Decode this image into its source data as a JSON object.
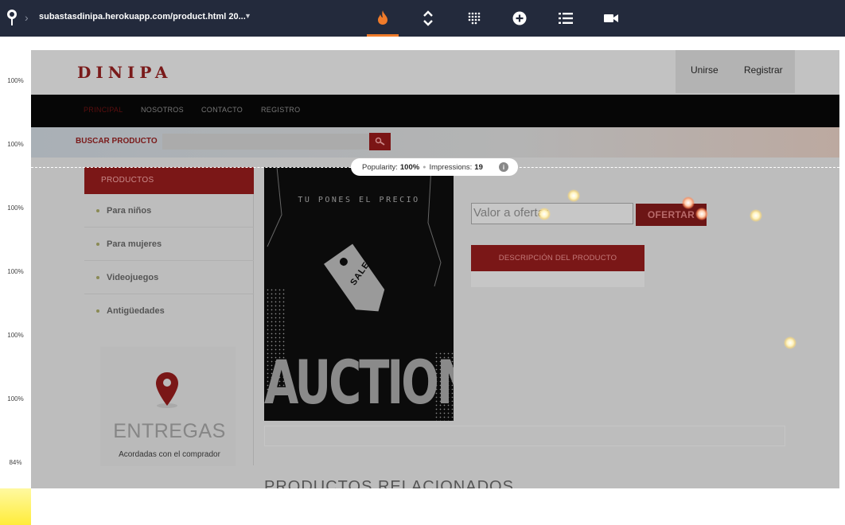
{
  "toolbar": {
    "url": "subastasdinipa.herokuapp.com/product.html 20...",
    "tools": [
      "heatmap-icon",
      "scroll-depth-icon",
      "click-map-icon",
      "add-icon",
      "list-icon",
      "video-icon"
    ],
    "accent": "#f07b2a"
  },
  "gutter": {
    "percentages": [
      "100%",
      "100%",
      "100%",
      "100%",
      "100%",
      "100%",
      "84%"
    ]
  },
  "site": {
    "brand": "DINIPA",
    "header_links": {
      "join": "Unirse",
      "register": "Registrar"
    },
    "nav": [
      "PRINCIPAL",
      "NOSOTROS",
      "CONTACTO",
      "REGISTRO"
    ],
    "search_label": "BUSCAR PRODUCTO",
    "categories_title": "PRODUCTOS",
    "categories": [
      "Para niños",
      "Para mujeres",
      "Videojuegos",
      "Antigüedades"
    ],
    "delivery_title": "ENTREGAS",
    "delivery_subtitle": "Acordadas con el comprador",
    "poster_tagline": "TU PONES EL PRECIO",
    "poster_word": "AUCTION",
    "poster_tag": "SALE",
    "bid_placeholder": "Valor a ofertar",
    "bid_button": "OFERTAR",
    "description_button": "DESCRIPCIÓN DEL PRODUCTO",
    "related_title": "PRODUCTOS RELACIONADOS"
  },
  "popularity": {
    "popularity_label": "Popularity:",
    "popularity_value": "100%",
    "impressions_label": "Impressions:",
    "impressions_value": "19"
  }
}
